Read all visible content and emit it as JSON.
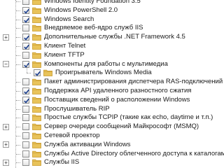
{
  "tree": {
    "items": [
      {
        "label": "Windows Identity Foundation 3.5",
        "checked": false,
        "indent": 0
      },
      {
        "label": "Windows PowerShell 2.0",
        "checked": true,
        "indent": 0
      },
      {
        "label": "Windows Search",
        "checked": true,
        "indent": 0
      },
      {
        "label": "Внедряемое веб-ядро служб IIS",
        "checked": false,
        "indent": 0
      },
      {
        "label": "Дополнительные службы .NET Framework 4.5",
        "checked": true,
        "indent": 0,
        "expander": "+"
      },
      {
        "label": "Клиент Telnet",
        "checked": true,
        "indent": 0
      },
      {
        "label": "Клиент TFTP",
        "checked": false,
        "indent": 0
      },
      {
        "label": "Компоненты для работы с мультимедиа",
        "checked": true,
        "indent": 0,
        "expander": "−"
      },
      {
        "label": "Проигрыватель Windows Media",
        "checked": true,
        "indent": 1
      },
      {
        "label": "Пакет администрирования диспетчера RAS-подключений (C",
        "checked": false,
        "indent": 0
      },
      {
        "label": "Поддержка API удаленного разностного сжатия",
        "checked": true,
        "indent": 0
      },
      {
        "label": "Поставщик сведений о расположении Windows",
        "checked": true,
        "indent": 0
      },
      {
        "label": "Прослушиватель RIP",
        "checked": false,
        "indent": 0
      },
      {
        "label": "Простые службы TCPIP (такие как echo, daytime и т.п.)",
        "checked": false,
        "indent": 0
      },
      {
        "label": "Сервер очереди сообщений Майкрософт (MSMQ)",
        "checked": false,
        "indent": 0,
        "expander": "+"
      },
      {
        "label": "Сетевой проектор",
        "checked": false,
        "indent": 0
      },
      {
        "label": "Служба активации Windows",
        "checked": false,
        "indent": 0,
        "expander": "+"
      },
      {
        "label": "Службы Active Directory облегченного доступа к каталогам",
        "checked": false,
        "indent": 0
      },
      {
        "label": "Службы IIS",
        "checked": false,
        "indent": 0,
        "expander": "+"
      }
    ]
  },
  "colors": {
    "folder": "#e8c35a",
    "folder_dark": "#c99a2e",
    "check_mark": "#1b3f8f"
  },
  "icons": {
    "expander": "tree-expander-icon",
    "checkbox": "checkbox-icon",
    "folder": "folder-icon"
  }
}
